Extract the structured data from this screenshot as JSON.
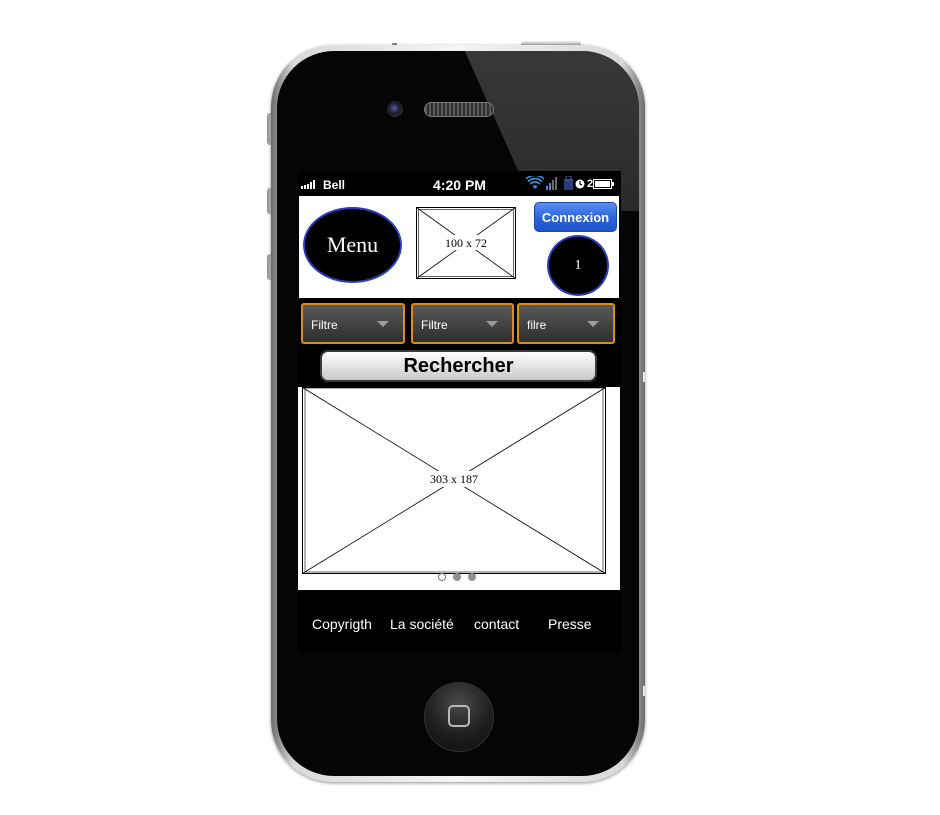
{
  "status_bar": {
    "carrier": "Bell",
    "time": "4:20 PM",
    "battery_percent": "2",
    "icons": [
      "signal-icon",
      "wifi-icon",
      "cellular-bars-icon",
      "lock-icon",
      "alarm-icon",
      "battery-icon"
    ]
  },
  "header": {
    "menu_label": "Menu",
    "logo_placeholder": "100 x 72",
    "connexion_label": "Connexion",
    "badge_value": "1"
  },
  "filters": [
    {
      "label": "Filtre"
    },
    {
      "label": "Filtre"
    },
    {
      "label": "filre"
    }
  ],
  "search": {
    "label": "Rechercher"
  },
  "carousel": {
    "placeholder": "303 x 187",
    "active_index": 0,
    "slide_count": 3
  },
  "footer": {
    "links": [
      "Copyrigth",
      "La société",
      "contact",
      "Presse"
    ]
  },
  "colors": {
    "accent_blue": "#2a62dc",
    "filter_border": "#e08a1a",
    "outline_blue": "#2a3ec0"
  }
}
